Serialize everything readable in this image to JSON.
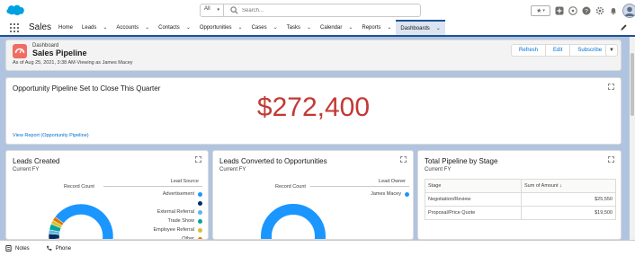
{
  "colors": {
    "brand": "#00a1e0",
    "nav_accent": "#1b5297",
    "metric": "#c23934",
    "link": "#0070d2"
  },
  "search": {
    "scope": "All",
    "placeholder": "Search..."
  },
  "app": {
    "name": "Sales"
  },
  "nav": {
    "tabs": [
      {
        "label": "Home",
        "dropdown": false
      },
      {
        "label": "Leads",
        "dropdown": true
      },
      {
        "label": "Accounts",
        "dropdown": true
      },
      {
        "label": "Contacts",
        "dropdown": true
      },
      {
        "label": "Opportunities",
        "dropdown": true
      },
      {
        "label": "Cases",
        "dropdown": true
      },
      {
        "label": "Tasks",
        "dropdown": true
      },
      {
        "label": "Calendar",
        "dropdown": true
      },
      {
        "label": "Reports",
        "dropdown": true
      },
      {
        "label": "Dashboards",
        "dropdown": true,
        "active": true
      }
    ]
  },
  "dashboard": {
    "type_label": "Dashboard",
    "title": "Sales Pipeline",
    "meta": "As of Aug 25, 2021, 3:38 AM·Viewing as James Macey",
    "buttons": {
      "refresh": "Refresh",
      "edit": "Edit",
      "subscribe": "Subscribe"
    }
  },
  "pipeline_card": {
    "title": "Opportunity Pipeline Set to Close This Quarter",
    "value": "$272,400",
    "link": "View Report (Opportunity Pipeline)"
  },
  "leads_created": {
    "title": "Leads Created",
    "subtitle": "Current FY",
    "chart_label": "Record Count",
    "legend_title": "Lead Source",
    "legend": [
      {
        "label": "Advertisement",
        "color": "#1b96ff"
      },
      {
        "label": "",
        "color": "#032d60"
      },
      {
        "label": "External Referral",
        "color": "#5eb6e6"
      },
      {
        "label": "Trade Show",
        "color": "#06a59a"
      },
      {
        "label": "Employee Referral",
        "color": "#d8c032"
      },
      {
        "label": "Other",
        "color": "#dd7a01"
      }
    ],
    "chart_data": {
      "type": "pie",
      "donut": true,
      "title": "Leads Created",
      "categories": [
        "Advertisement",
        "",
        "External Referral",
        "Trade Show",
        "Employee Referral",
        "Other"
      ],
      "values": [
        88,
        3,
        2,
        3,
        2,
        2
      ]
    }
  },
  "leads_converted": {
    "title": "Leads Converted to Opportunities",
    "subtitle": "Current FY",
    "chart_label": "Record Count",
    "legend_title": "Lead Owner",
    "legend": [
      {
        "label": "James Macey",
        "color": "#1b96ff"
      }
    ],
    "chart_data": {
      "type": "pie",
      "donut": true,
      "title": "Leads Converted to Opportunities",
      "categories": [
        "James Macey"
      ],
      "values": [
        100
      ]
    }
  },
  "pipeline_stage": {
    "title": "Total Pipeline by Stage",
    "subtitle": "Current FY",
    "columns": [
      "Stage",
      "Sum of Amount"
    ],
    "rows": [
      {
        "stage": "Negotiation/Review",
        "amount": "$25,550"
      },
      {
        "stage": "Proposal/Price Quote",
        "amount": "$19,500"
      }
    ],
    "chart_data": {
      "type": "table",
      "columns": [
        "Stage",
        "Sum of Amount"
      ],
      "rows": [
        [
          "Negotiation/Review",
          25550
        ],
        [
          "Proposal/Price Quote",
          19500
        ]
      ]
    }
  },
  "bottom": {
    "notes": "Notes",
    "phone": "Phone"
  }
}
